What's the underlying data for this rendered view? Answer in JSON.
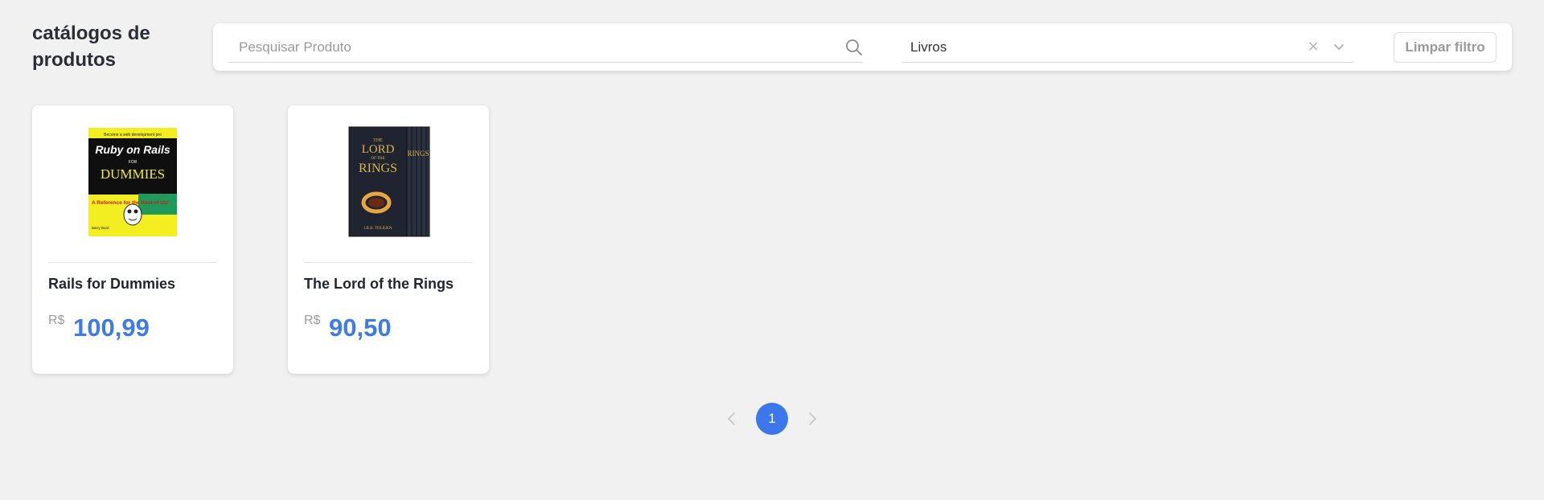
{
  "header": {
    "title": "catálogos de produtos"
  },
  "filters": {
    "search": {
      "placeholder": "Pesquisar Produto",
      "value": ""
    },
    "category": {
      "selected": "Livros"
    },
    "clear_label": "Limpar filtro"
  },
  "products": [
    {
      "name": "Rails for Dummies",
      "currency": "R$",
      "price": "100,99",
      "image_icon": "book-cover-ruby-on-rails-for-dummies",
      "cover_text": {
        "tagline": "Become a web development pro",
        "title": "Ruby on Rails",
        "for": "FOR",
        "brand": "DUMMIES",
        "blurb": "A Reference for the Rest of Us!",
        "author": "Barry Burd"
      }
    },
    {
      "name": "The Lord of the Rings",
      "currency": "R$",
      "price": "90,50",
      "image_icon": "book-boxset-lord-of-the-rings",
      "cover_text": {
        "title_top": "THE",
        "title_mid": "LORD",
        "title_of": "OF THE",
        "title_main": "RINGS",
        "author": "J.R.R. TOLKIEN"
      }
    }
  ],
  "pagination": {
    "current_page": "1"
  },
  "colors": {
    "accent": "#3c78ec",
    "price": "#3f7be6",
    "background": "#f1f1f1"
  }
}
